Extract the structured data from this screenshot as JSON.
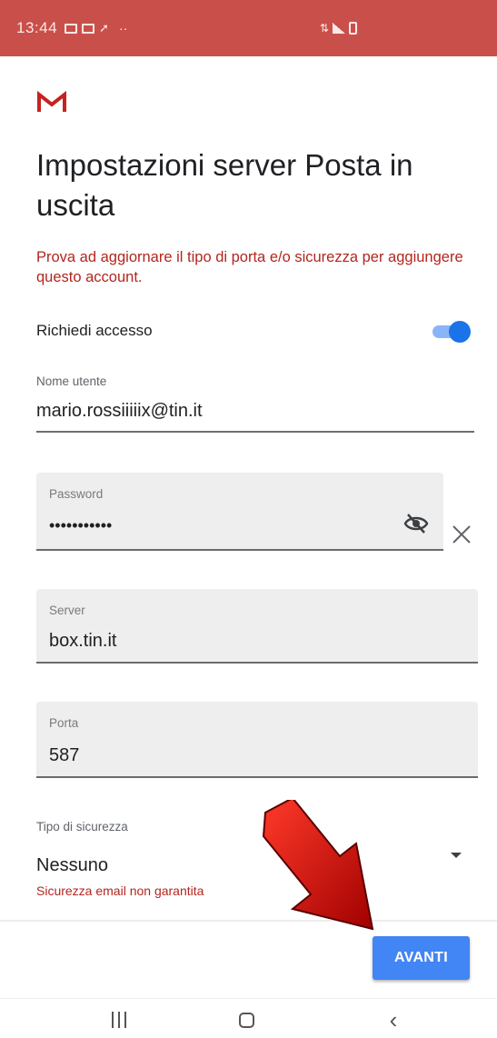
{
  "status_bar": {
    "time": "13:44"
  },
  "logo_icon": "gmail-m-icon",
  "title": "Impostazioni server Posta in uscita",
  "warning": "Prova ad aggiornare il tipo di porta e/o sicurezza per aggiungere questo account.",
  "require_login": {
    "label": "Richiedi accesso",
    "enabled": true
  },
  "username": {
    "label": "Nome utente",
    "value": "mario.rossiiiiix@tin.it"
  },
  "password": {
    "label": "Password",
    "value": "•••••••••••"
  },
  "server": {
    "label": "Server",
    "value": "box.tin.it"
  },
  "port": {
    "label": "Porta",
    "value": "587"
  },
  "security": {
    "label": "Tipo di sicurezza",
    "value": "Nessuno",
    "help": "Sicurezza email non garantita"
  },
  "next_button": "AVANTI",
  "colors": {
    "accent": "#4285f4",
    "error": "#b3261e",
    "status_bar": "#c9504a"
  }
}
